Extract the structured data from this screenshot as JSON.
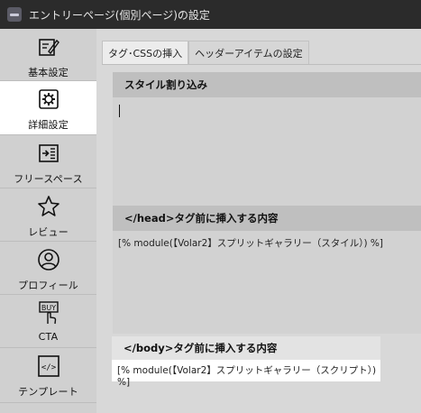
{
  "window": {
    "title": "エントリーページ(個別ページ)の設定"
  },
  "sidebar": {
    "items": [
      {
        "label": "基本設定",
        "icon": "edit-icon"
      },
      {
        "label": "詳細設定",
        "icon": "settings-icon",
        "active": true
      },
      {
        "label": "フリースペース",
        "icon": "free-space-icon"
      },
      {
        "label": "レビュー",
        "icon": "star-icon"
      },
      {
        "label": "プロフィール",
        "icon": "profile-icon"
      },
      {
        "label": "CTA",
        "icon": "buy-icon"
      },
      {
        "label": "テンプレート",
        "icon": "template-icon"
      }
    ]
  },
  "tabs": [
    {
      "label": "タグ･CSSの挿入",
      "active": true
    },
    {
      "label": "ヘッダーアイテムの設定",
      "active": false
    }
  ],
  "sections": {
    "style_insert": {
      "title": "スタイル割り込み",
      "value": ""
    },
    "head_insert": {
      "title": "</head>タグ前に挿入する内容",
      "value": "[% module(【Volar2】スプリットギャラリー（スタイル）) %]"
    },
    "body_insert": {
      "title": "</body>タグ前に挿入する内容",
      "value": "[% module(【Volar2】スプリットギャラリー（スクリプト）) %]"
    }
  },
  "colors": {
    "titlebar": "#2b2b2b",
    "sidebar": "#d0d0d0",
    "active_item": "#ffffff",
    "section_header": "#bfbfbf"
  }
}
